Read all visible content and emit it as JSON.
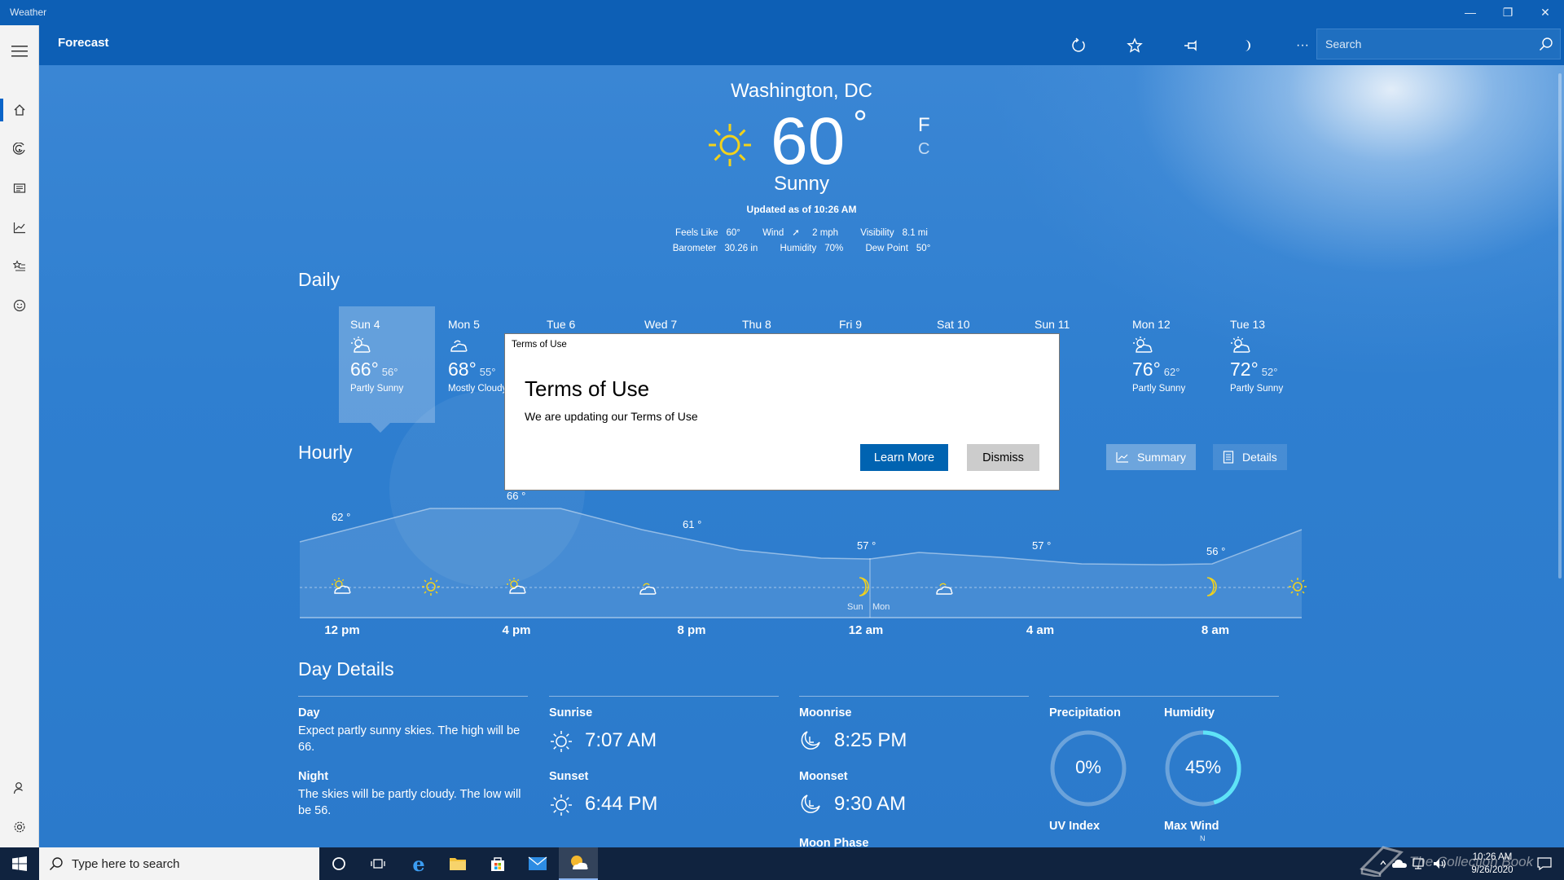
{
  "window": {
    "title": "Weather"
  },
  "header": {
    "title": "Forecast",
    "search_placeholder": "Search"
  },
  "current": {
    "city": "Washington, DC",
    "temp": "60",
    "degree": "°",
    "unit_f": "F",
    "unit_c": "C",
    "condition": "Sunny",
    "updated": "Updated as of 10:26 AM",
    "feels_like_label": "Feels Like",
    "feels_like": "60°",
    "wind_label": "Wind",
    "wind": "2 mph",
    "visibility_label": "Visibility",
    "visibility": "8.1 mi",
    "barometer_label": "Barometer",
    "barometer": "30.26 in",
    "humidity_label": "Humidity",
    "humidity": "70%",
    "dew_point_label": "Dew Point",
    "dew_point": "50°"
  },
  "daily": {
    "title": "Daily",
    "days": [
      {
        "name": "Sun 4",
        "hi": "66°",
        "lo": "56°",
        "cond": "Partly Sunny",
        "icon": "partly-sunny-icon"
      },
      {
        "name": "Mon 5",
        "hi": "68°",
        "lo": "55°",
        "cond": "Mostly Cloudy",
        "icon": "mostly-cloudy-icon"
      },
      {
        "name": "Tue 6"
      },
      {
        "name": "Wed 7"
      },
      {
        "name": "Thu 8"
      },
      {
        "name": "Fri 9"
      },
      {
        "name": "Sat 10"
      },
      {
        "name": "Sun 11"
      },
      {
        "name": "Mon 12",
        "hi": "76°",
        "lo": "62°",
        "cond": "Partly Sunny",
        "icon": "partly-sunny-icon"
      },
      {
        "name": "Tue 13",
        "hi": "72°",
        "lo": "52°",
        "cond": "Partly Sunny",
        "icon": "partly-sunny-icon"
      }
    ]
  },
  "hourly": {
    "title": "Hourly",
    "summary_label": "Summary",
    "details_label": "Details",
    "temp_labels": [
      "62 °",
      "66 °",
      "61 °",
      "57 °",
      "57 °",
      "56 °"
    ],
    "time_labels": [
      "12 pm",
      "4 pm",
      "8 pm",
      "12 am",
      "4 am",
      "8 am"
    ],
    "day_marks": [
      "Sun",
      "Mon"
    ]
  },
  "day_details": {
    "title": "Day Details",
    "day_label": "Day",
    "day_text_1": "Expect partly sunny skies. The high will be",
    "day_text_2": "66.",
    "night_label": "Night",
    "night_text_1": "The skies will be partly cloudy. The low will",
    "night_text_2": "be 56.",
    "sunrise_label": "Sunrise",
    "sunrise": "7:07 AM",
    "sunset_label": "Sunset",
    "sunset": "6:44 PM",
    "moonrise_label": "Moonrise",
    "moonrise": "8:25 PM",
    "moonset_label": "Moonset",
    "moonset": "9:30 AM",
    "moon_phase_label": "Moon Phase",
    "precip_label": "Precipitation",
    "precip": "0%",
    "precip_fraction": 0,
    "humidity_label": "Humidity",
    "humidity": "45%",
    "humidity_fraction": 0.45,
    "uv_label": "UV Index",
    "maxwind_label": "Max Wind",
    "maxwind_dir": "N"
  },
  "dialog": {
    "window_title": "Terms of Use",
    "heading": "Terms of Use",
    "body": "We are updating our Terms of Use",
    "primary": "Learn More",
    "secondary": "Dismiss"
  },
  "taskbar": {
    "search_placeholder": "Type here to search",
    "time": "10:26 AM",
    "date": "9/26/2020"
  },
  "watermark": "The Collection Book",
  "colors": {
    "accent": "#0063b1",
    "sun": "#f2d21b",
    "humidity_ring": "#5ee3f7"
  }
}
